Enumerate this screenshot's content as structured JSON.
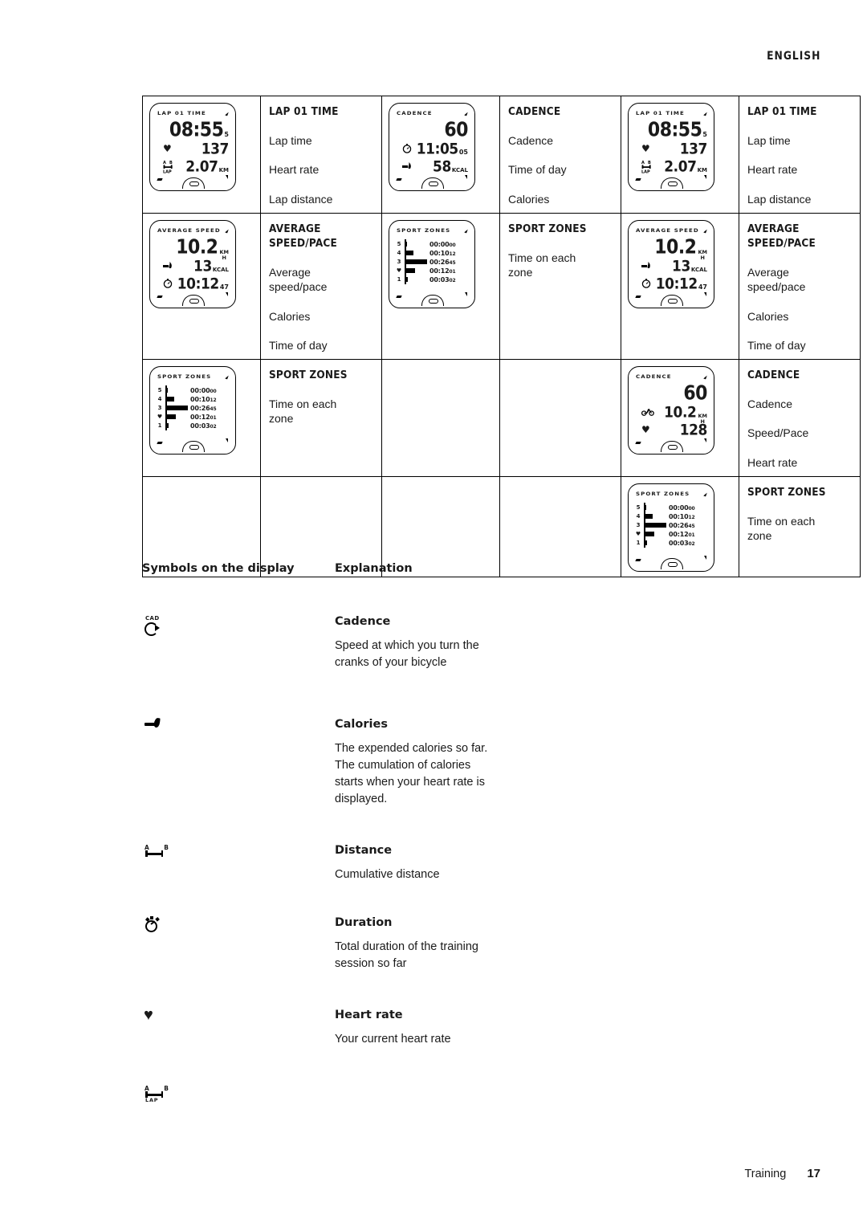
{
  "header": {
    "language": "ENGLISH"
  },
  "footer": {
    "section": "Training",
    "page": "17"
  },
  "table": {
    "rows": [
      {
        "cells": [
          {
            "type": "display",
            "display": "lap01_a"
          },
          {
            "type": "text",
            "title": "LAP 01 TIME",
            "lines": [
              "Lap time",
              "Heart rate",
              "Lap distance"
            ]
          },
          {
            "type": "display",
            "display": "cadence_time_cal"
          },
          {
            "type": "text",
            "title": "CADENCE",
            "lines": [
              "Cadence",
              "Time of day",
              "Calories"
            ]
          },
          {
            "type": "display",
            "display": "lap01_a"
          },
          {
            "type": "text",
            "title": "LAP 01 TIME",
            "lines": [
              "Lap time",
              "Heart rate",
              "Lap distance"
            ]
          }
        ]
      },
      {
        "cells": [
          {
            "type": "display",
            "display": "avg_speed"
          },
          {
            "type": "text",
            "title": "AVERAGE\nSPEED/PACE",
            "lines": [
              "Average\nspeed/pace",
              "Calories",
              "Time of day"
            ]
          },
          {
            "type": "display",
            "display": "sport_zones"
          },
          {
            "type": "text",
            "title": "SPORT ZONES",
            "lines": [
              "Time on each\nzone"
            ]
          },
          {
            "type": "display",
            "display": "avg_speed"
          },
          {
            "type": "text",
            "title": "AVERAGE\nSPEED/PACE",
            "lines": [
              "Average\nspeed/pace",
              "Calories",
              "Time of day"
            ]
          }
        ]
      },
      {
        "cells": [
          {
            "type": "display",
            "display": "sport_zones"
          },
          {
            "type": "text",
            "title": "SPORT ZONES",
            "lines": [
              "Time on each\nzone"
            ]
          },
          {
            "type": "empty"
          },
          {
            "type": "empty"
          },
          {
            "type": "display",
            "display": "cadence_speed_hr"
          },
          {
            "type": "text",
            "title": "CADENCE",
            "lines": [
              "Cadence",
              "Speed/Pace",
              "Heart rate"
            ]
          }
        ]
      },
      {
        "cells": [
          {
            "type": "empty"
          },
          {
            "type": "empty"
          },
          {
            "type": "empty"
          },
          {
            "type": "empty"
          },
          {
            "type": "display",
            "display": "sport_zones"
          },
          {
            "type": "text",
            "title": "SPORT ZONES",
            "lines": [
              "Time on each\nzone"
            ]
          }
        ]
      }
    ]
  },
  "displays": {
    "lap01_a": {
      "label": "LAP 01 TIME",
      "line1": {
        "value": "08:55",
        "sub": "5"
      },
      "line2": {
        "icon": "heart-icon",
        "value": "137"
      },
      "line3": {
        "icon": "lap-distance-icon",
        "value": "2.07",
        "unit": "KM"
      }
    },
    "cadence_time_cal": {
      "label": "CADENCE",
      "line1": {
        "value": "60"
      },
      "line2": {
        "icon": "stopwatch-icon",
        "value": "11:05",
        "sub": "05"
      },
      "line3": {
        "icon": "calories-icon",
        "value": "58",
        "unit": "KCAL"
      }
    },
    "avg_speed": {
      "label": "AVERAGE SPEED",
      "line1": {
        "value": "10.2",
        "unit_top": "KM",
        "unit_bottom": "H"
      },
      "line2": {
        "icon": "calories-icon",
        "value": "13",
        "unit": "KCAL"
      },
      "line3": {
        "icon": "stopwatch-icon",
        "value": "10:12",
        "sub": "47"
      }
    },
    "cadence_speed_hr": {
      "label": "CADENCE",
      "line1": {
        "value": "60"
      },
      "line2": {
        "icon": "bicycle-icon",
        "value": "10.2",
        "unit_top": "KM",
        "unit_bottom": "H"
      },
      "line3": {
        "icon": "heart-icon",
        "value": "128"
      }
    },
    "sport_zones": {
      "label": "SPORT ZONES",
      "zones": [
        {
          "zone": "5",
          "time": "00:00",
          "hundredths": "00",
          "bar": 3
        },
        {
          "zone": "4",
          "time": "00:10",
          "hundredths": "12",
          "bar": 11
        },
        {
          "zone": "3",
          "time": "00:26",
          "hundredths": "45",
          "bar": 28
        },
        {
          "zone": "♥",
          "time": "00:12",
          "hundredths": "01",
          "bar": 13
        },
        {
          "zone": "1",
          "time": "00:03",
          "hundredths": "02",
          "bar": 4
        }
      ]
    }
  },
  "symbols_section": {
    "heading_left": "Symbols on the display",
    "heading_right": "Explanation",
    "rows": [
      {
        "icon": "cadence-icon",
        "term": "Cadence",
        "description": "Speed at which you turn the\ncranks of your bicycle"
      },
      {
        "icon": "calories-icon",
        "term": "Calories",
        "description": "The expended calories so far.\nThe cumulation of calories\nstarts when your heart rate is\ndisplayed."
      },
      {
        "icon": "distance-icon",
        "term": "Distance",
        "description": "Cumulative distance"
      },
      {
        "icon": "duration-icon",
        "term": "Duration",
        "description": "Total duration of the training\nsession so far"
      },
      {
        "icon": "heart-rate-icon",
        "term": "Heart rate",
        "description": "Your current heart rate"
      },
      {
        "icon": "lap-icon",
        "term": "",
        "description": ""
      }
    ],
    "distance_icon_labels": {
      "a": "A",
      "b": "B"
    },
    "lap_icon_labels": {
      "a": "A",
      "b": "B",
      "word": "LAP"
    },
    "cadence_icon_label": "CAD"
  }
}
